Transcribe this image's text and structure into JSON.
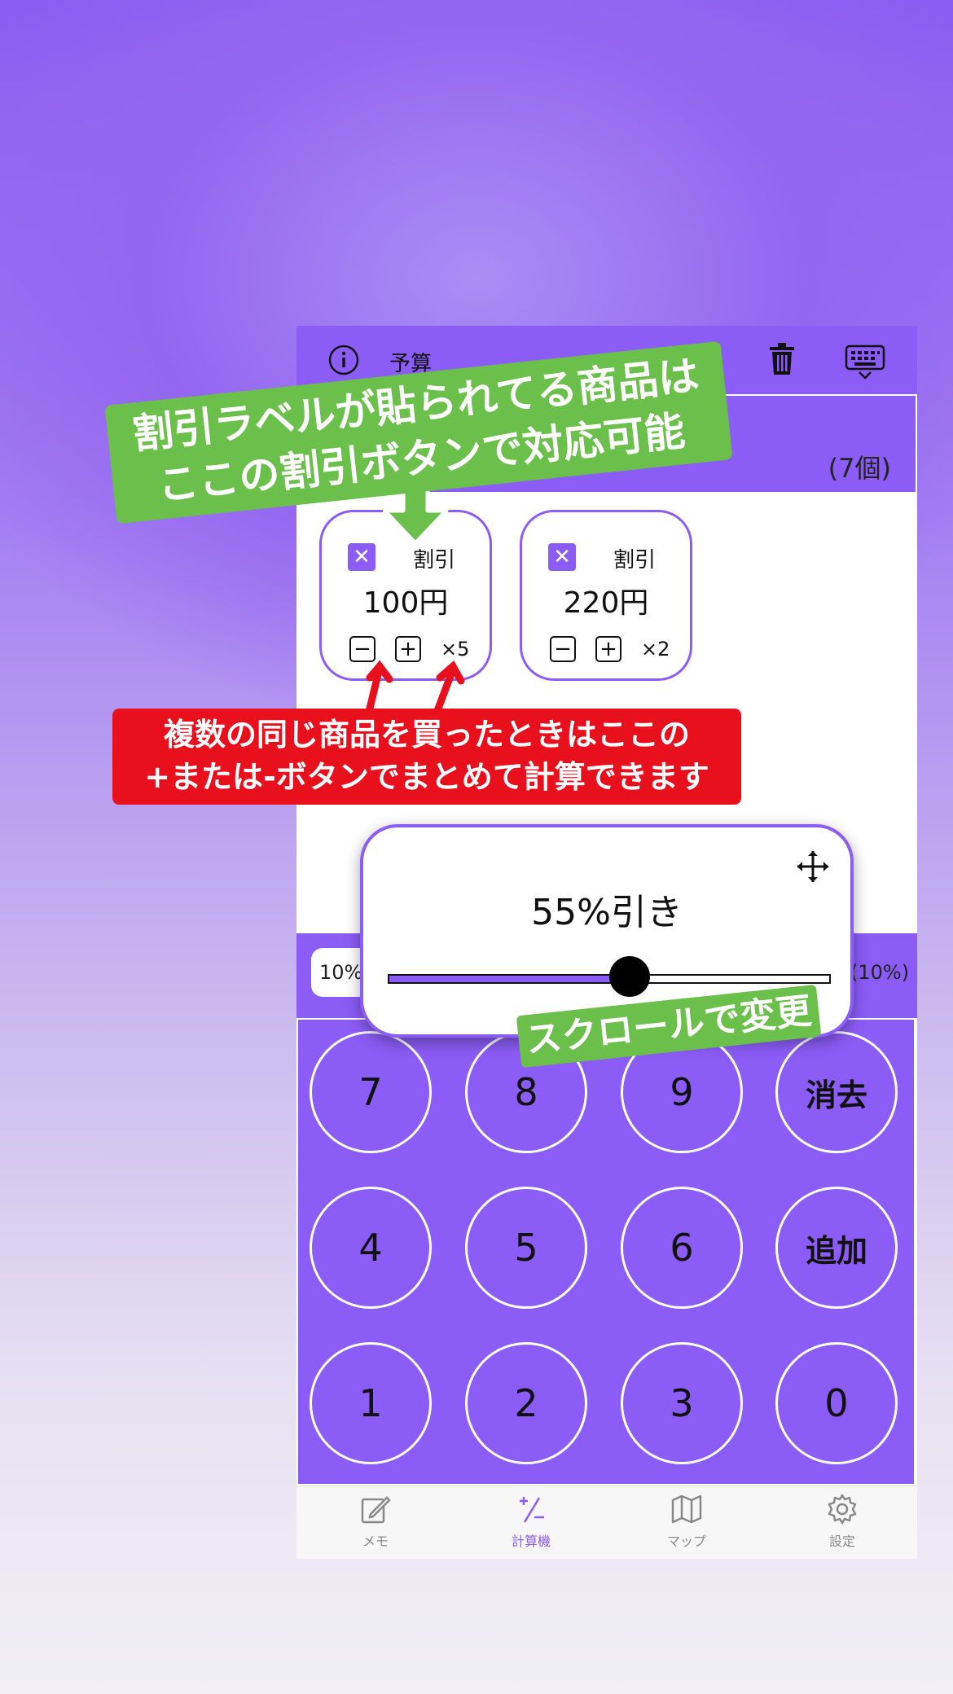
{
  "topbar": {
    "info_icon": "info-circle-icon",
    "budget_label": "予算",
    "trash_icon": "trash-icon",
    "keyboard_icon": "keyboard-icon"
  },
  "summary": {
    "count": "(7個)"
  },
  "items": [
    {
      "label": "割引",
      "price": "100円",
      "qty": "×5"
    },
    {
      "label": "割引",
      "price": "220円",
      "qty": "×2"
    }
  ],
  "rates": {
    "left": "10%",
    "right": "(10%)"
  },
  "discount_popup": {
    "text": "55%引き",
    "slider_value": 0.55
  },
  "keypad": [
    [
      "7",
      "8",
      "9",
      "消去"
    ],
    [
      "4",
      "5",
      "6",
      "追加"
    ],
    [
      "1",
      "2",
      "3",
      "0"
    ]
  ],
  "tabs": [
    {
      "label": "メモ",
      "icon": "memo-edit-icon"
    },
    {
      "label": "計算機",
      "icon": "plus-minus-icon"
    },
    {
      "label": "マップ",
      "icon": "map-icon"
    },
    {
      "label": "設定",
      "icon": "gear-icon"
    }
  ],
  "annotations": {
    "discount_line1": "割引ラベルが貼られてる商品は",
    "discount_line2": "ここの割引ボタンで対応可能",
    "quantity_line1": "複数の同じ商品を買ったときはここの",
    "quantity_line2": "+または-ボタンでまとめて計算できます",
    "scroll": "スクロールで変更"
  },
  "colors": {
    "accent": "#8b5cf6",
    "green": "#6bbf4b",
    "red": "#e8101d"
  }
}
